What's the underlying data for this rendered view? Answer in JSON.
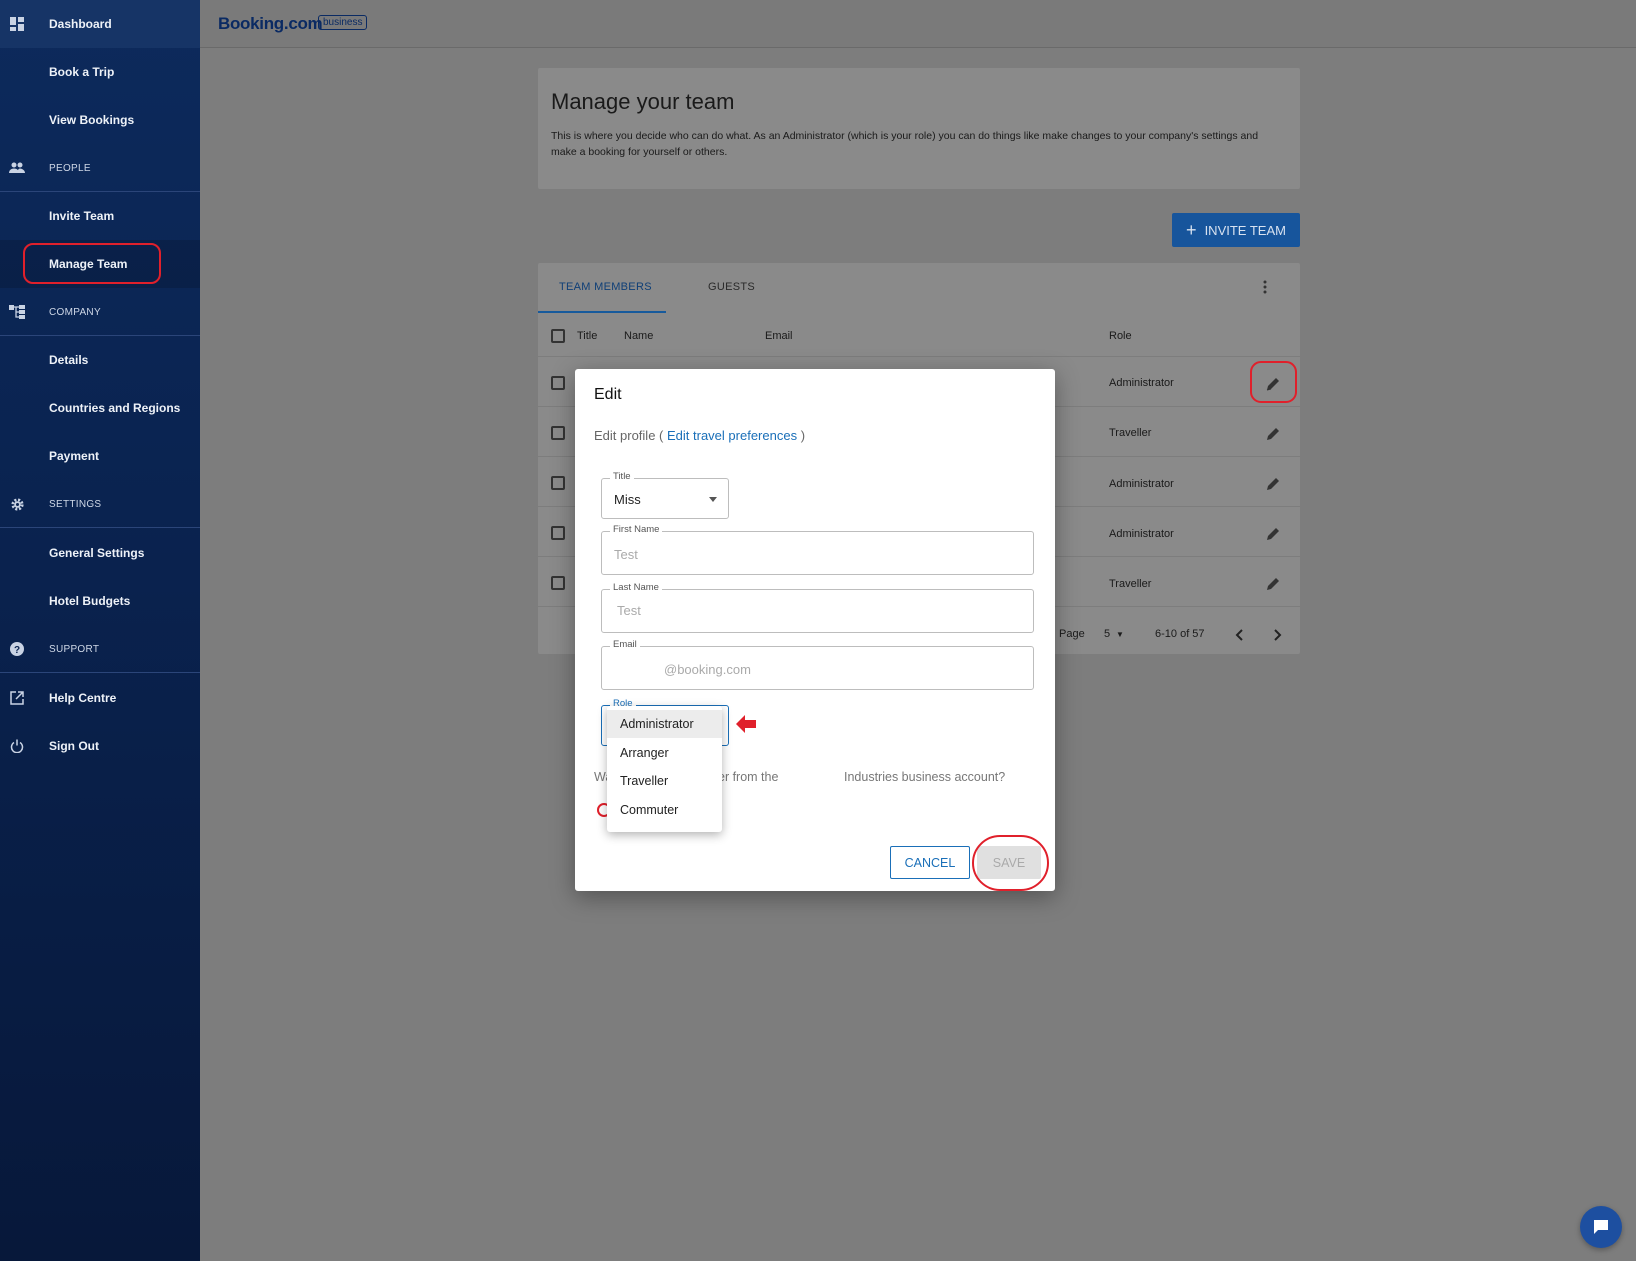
{
  "header": {
    "logo": "Booking.com",
    "logo_badge": "business"
  },
  "sidebar": {
    "items": [
      {
        "label": "Dashboard",
        "icon": "dashboard-icon"
      },
      {
        "label": "Book a Trip"
      },
      {
        "label": "View Bookings"
      },
      {
        "label": "PEOPLE",
        "icon": "people-icon",
        "section": true
      },
      {
        "label": "Invite Team"
      },
      {
        "label": "Manage Team"
      },
      {
        "label": "COMPANY",
        "icon": "company-icon",
        "section": true
      },
      {
        "label": "Details"
      },
      {
        "label": "Countries and Regions"
      },
      {
        "label": "Payment"
      },
      {
        "label": "SETTINGS",
        "icon": "gear-icon",
        "section": true
      },
      {
        "label": "General Settings"
      },
      {
        "label": "Hotel Budgets"
      },
      {
        "label": "SUPPORT",
        "icon": "help-icon",
        "section": true
      },
      {
        "label": "Help Centre",
        "icon": "external-link-icon"
      },
      {
        "label": "Sign Out",
        "icon": "power-icon"
      }
    ]
  },
  "page": {
    "title": "Manage your team",
    "description": "This is where you decide who can do what. As an Administrator (which is your role) you can do things like make changes to your company's settings and make a booking for yourself or others.",
    "invite_button": "INVITE TEAM"
  },
  "table": {
    "tabs": [
      "TEAM MEMBERS",
      "GUESTS"
    ],
    "headers": {
      "title": "Title",
      "name": "Name",
      "email": "Email",
      "role": "Role"
    },
    "rows": [
      {
        "role": "Administrator"
      },
      {
        "role": "Traveller"
      },
      {
        "role": "Administrator"
      },
      {
        "role": "Administrator"
      },
      {
        "role": "Traveller"
      }
    ],
    "pager": {
      "label": "Page",
      "size": "5",
      "range": "6-10 of 57"
    }
  },
  "modal": {
    "title": "Edit",
    "sub_prefix": "Edit profile (",
    "sub_link": "Edit travel preferences",
    "sub_suffix": ")",
    "title_field": {
      "label": "Title",
      "value": "Miss"
    },
    "first_name": {
      "label": "First Name",
      "value": "Test"
    },
    "last_name": {
      "label": "Last Name",
      "value": "Test"
    },
    "email": {
      "label": "Email",
      "value": "@booking.com"
    },
    "role": {
      "label": "Role",
      "options": [
        "Administrator",
        "Arranger",
        "Traveller",
        "Commuter"
      ],
      "selected": "Administrator"
    },
    "remove_text_a": "Wa",
    "remove_text_b": "er from the",
    "remove_text_c": "Industries business account?",
    "cancel": "CANCEL",
    "save": "SAVE"
  },
  "colors": {
    "accent": "#1a6fb8",
    "highlight": "#e0202b",
    "sidebar": "#0a2350"
  }
}
